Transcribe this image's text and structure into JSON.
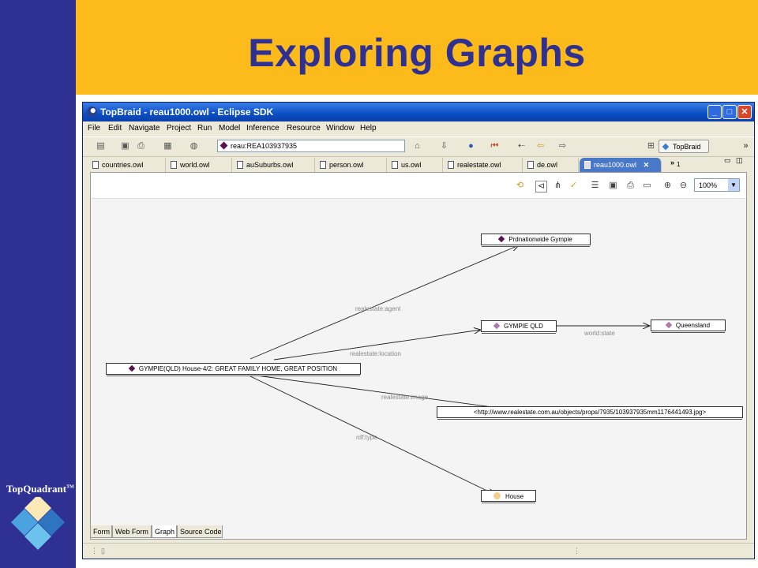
{
  "slide": {
    "title": "Exploring Graphs",
    "logo_text": "TopQuadrant",
    "logo_tm": "TM",
    "colors": {
      "sidebar": "#2e3192",
      "header": "#fdbb1b",
      "title": "#2e3192"
    }
  },
  "window": {
    "title": "TopBraid - reau1000.owl - Eclipse SDK",
    "controls": [
      "minimize",
      "maximize",
      "close"
    ]
  },
  "menu": [
    "File",
    "Edit",
    "Navigate",
    "Project",
    "Run",
    "Model",
    "Inference",
    "Resource",
    "Window",
    "Help"
  ],
  "toolbar": {
    "address_value": "reau:REA103937935",
    "perspective_label": "TopBraid",
    "overflow": "»"
  },
  "tabs": [
    {
      "label": "countries.owl"
    },
    {
      "label": "world.owl"
    },
    {
      "label": "auSuburbs.owl"
    },
    {
      "label": "person.owl"
    },
    {
      "label": "us.owl"
    },
    {
      "label": "realestate.owl"
    },
    {
      "label": "de.owl"
    },
    {
      "label": "reau1000.owl",
      "active": true,
      "close": "✕"
    }
  ],
  "tabs_overflow": {
    "glyph": "»",
    "count": "1"
  },
  "graph_toolbar": {
    "zoom": "100%"
  },
  "graph": {
    "nodes": {
      "root": "GYMPIE(QLD) House-4/2: GREAT FAMILY HOME, GREAT POSITION",
      "agent": "Prdnationwide  Gympie",
      "location": "GYMPIE QLD",
      "state": "Queensland",
      "image": "<http://www.realestate.com.au/objects/props/7935/103937935mm1176441493.jpg>",
      "type": "House"
    },
    "edges": {
      "agent": "realestate:agent",
      "location": "realestate:location",
      "state": "world:state",
      "image": "realestate:image",
      "type": "rdf:type"
    },
    "colors": {
      "instance": "#5a1150",
      "resource": "#b07aa8",
      "class": "#f2d08c",
      "edge": "#222222"
    }
  },
  "bottom_tabs": [
    {
      "label": "Form"
    },
    {
      "label": "Web Form"
    },
    {
      "label": "Graph",
      "active": true
    },
    {
      "label": "Source Code"
    }
  ]
}
